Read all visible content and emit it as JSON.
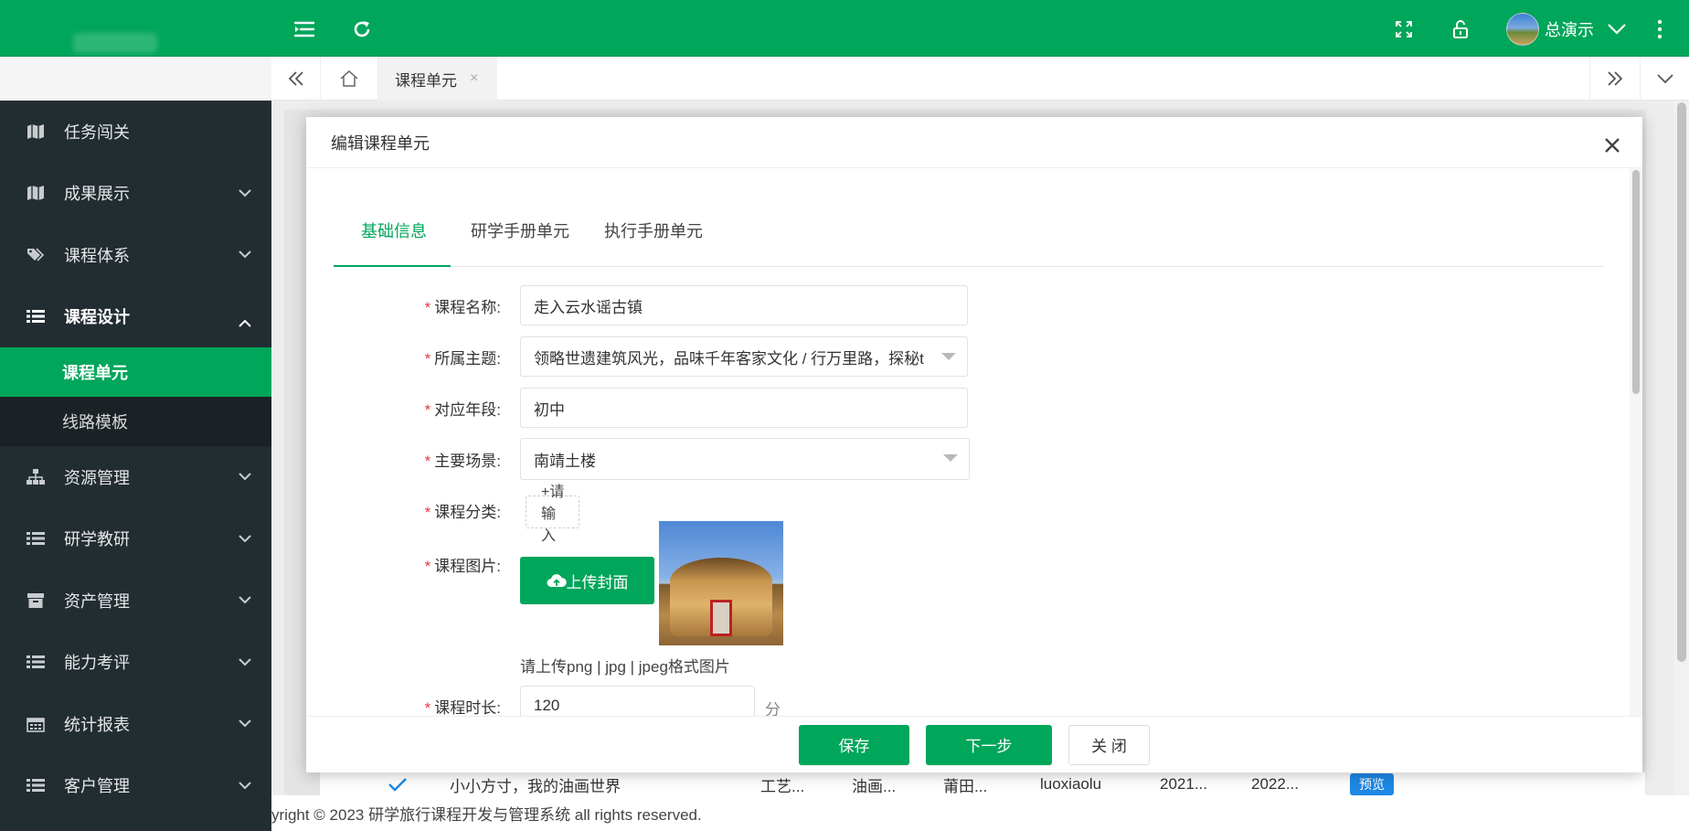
{
  "header": {
    "user_name": "总演示",
    "icons": [
      "menu-icon",
      "refresh-icon",
      "fullscreen-icon",
      "lock-icon",
      "chevron-down-icon",
      "more-icon"
    ]
  },
  "tabbar": {
    "tabs": [
      {
        "label": "课程单元"
      }
    ]
  },
  "sidebar": {
    "items": [
      {
        "label": "任务闯关",
        "icon": "map-icon"
      },
      {
        "label": "成果展示",
        "icon": "map-icon"
      },
      {
        "label": "课程体系",
        "icon": "tags-icon"
      },
      {
        "label": "课程设计",
        "icon": "list-icon"
      },
      {
        "label": "资源管理",
        "icon": "sitemap-icon"
      },
      {
        "label": "研学教研",
        "icon": "list-icon"
      },
      {
        "label": "资产管理",
        "icon": "archive-icon"
      },
      {
        "label": "能力考评",
        "icon": "list-icon"
      },
      {
        "label": "统计报表",
        "icon": "calendar-icon"
      },
      {
        "label": "客户管理",
        "icon": "list-icon"
      }
    ],
    "sub_items": [
      {
        "label": "课程单元",
        "active": true
      },
      {
        "label": "线路模板",
        "active": false
      }
    ]
  },
  "background": {
    "row": {
      "title": "小小方寸，我的油画世界",
      "col1": "工艺...",
      "col2": "油画...",
      "col3": "莆田...",
      "col4": "luoxiaolu",
      "col5": "2021...",
      "col6": "2022...",
      "badge": "预览"
    },
    "footer": "yright © 2023 研学旅行课程开发与管理系统 all rights reserved."
  },
  "modal": {
    "title": "编辑课程单元",
    "tabs": [
      "基础信息",
      "研学手册单元",
      "执行手册单元"
    ],
    "fields": {
      "name": {
        "label": "课程名称:",
        "value": "走入云水谣古镇"
      },
      "theme": {
        "label": "所属主题:",
        "value": "领略世遗建筑风光，品味千年客家文化 / 行万里路，探秘t"
      },
      "grade": {
        "label": "对应年段:",
        "value": "初中"
      },
      "scene": {
        "label": "主要场景:",
        "value": "南靖土楼"
      },
      "category": {
        "label": "课程分类:",
        "add_label": "+请输入"
      },
      "image": {
        "label": "课程图片:",
        "upload_label": "上传封面",
        "hint": "请上传png | jpg | jpeg格式图片"
      },
      "duration": {
        "label": "课程时长:",
        "value": "120",
        "suffix": "分钟"
      }
    },
    "required_mark": "*",
    "buttons": {
      "save": "保存",
      "next": "下一步",
      "close": "关 闭"
    }
  },
  "colors": {
    "primary": "#00a65a",
    "sidebar": "#222d32",
    "sidebar_sub": "#1a2226",
    "required": "#e4393c",
    "badge": "#1e88e5"
  }
}
